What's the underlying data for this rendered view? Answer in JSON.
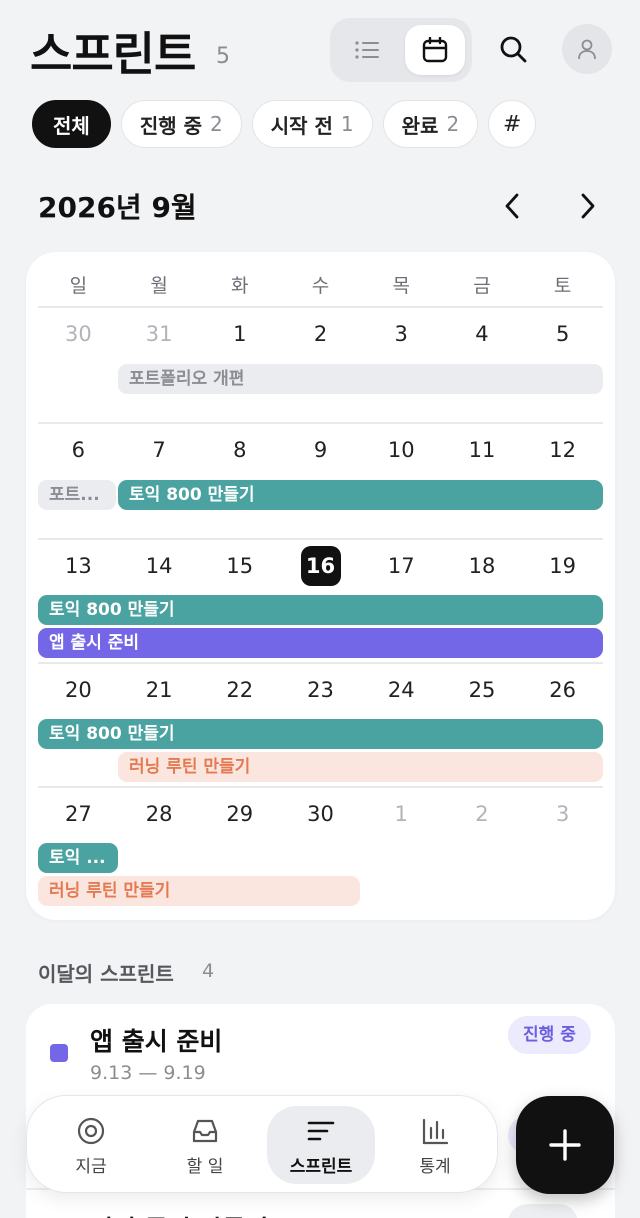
{
  "header": {
    "title": "스프린트",
    "count": "5",
    "view_toggle": {
      "list_icon": "list-icon",
      "calendar_icon": "calendar-icon",
      "active": "calendar"
    },
    "search_icon": "search-icon",
    "profile_icon": "user-icon"
  },
  "filters": [
    {
      "label": "전체",
      "count": "",
      "active": true
    },
    {
      "label": "진행 중",
      "count": "2",
      "active": false
    },
    {
      "label": "시작 전",
      "count": "1",
      "active": false
    },
    {
      "label": "완료",
      "count": "2",
      "active": false
    },
    {
      "label": "#",
      "count": "",
      "active": false
    }
  ],
  "calendar": {
    "month_label": "2026년 9월",
    "weekdays": [
      "일",
      "월",
      "화",
      "수",
      "목",
      "금",
      "토"
    ],
    "today": "16",
    "weeks": [
      {
        "days": [
          "30",
          "31",
          "1",
          "2",
          "3",
          "4",
          "5"
        ],
        "events": [
          {
            "label": "포트폴리오 개편",
            "color": "gray"
          }
        ]
      },
      {
        "days": [
          "6",
          "7",
          "8",
          "9",
          "10",
          "11",
          "12"
        ],
        "events": [
          {
            "label": "포트...",
            "color": "gray"
          },
          {
            "label": "토익 800 만들기",
            "color": "teal"
          }
        ]
      },
      {
        "days": [
          "13",
          "14",
          "15",
          "16",
          "17",
          "18",
          "19"
        ],
        "events": [
          {
            "label": "토익 800 만들기",
            "color": "teal"
          },
          {
            "label": "앱 출시 준비",
            "color": "purple"
          }
        ]
      },
      {
        "days": [
          "20",
          "21",
          "22",
          "23",
          "24",
          "25",
          "26"
        ],
        "events": [
          {
            "label": "토익 800 만들기",
            "color": "teal"
          },
          {
            "label": "러닝 루틴 만들기",
            "color": "peach"
          }
        ]
      },
      {
        "days": [
          "27",
          "28",
          "29",
          "30",
          "1",
          "2",
          "3"
        ],
        "events": [
          {
            "label": "토익 ...",
            "color": "teal"
          },
          {
            "label": "러닝 루틴 만들기",
            "color": "peach"
          }
        ]
      }
    ]
  },
  "month_sprints": {
    "title": "이달의 스프린트",
    "count": "4",
    "items": [
      {
        "name": "앱 출시 준비",
        "dates": "9.13 — 9.19",
        "status": "진행 중",
        "color": "#7367e8"
      },
      {
        "name": "러닝 루틴 만들기"
      }
    ]
  },
  "tabbar": [
    {
      "label": "지금",
      "icon": "target-icon",
      "active": false
    },
    {
      "label": "할 일",
      "icon": "inbox-icon",
      "active": false
    },
    {
      "label": "스프린트",
      "icon": "sprint-lines-icon",
      "active": true
    },
    {
      "label": "통계",
      "icon": "bar-chart-icon",
      "active": false
    }
  ],
  "fab": {
    "icon": "plus-icon"
  },
  "colors": {
    "teal": "#4aa3a1",
    "purple": "#7367e8",
    "peach_bg": "#fbe6df",
    "peach_text": "#e47a52",
    "gray_bg": "#ebecef"
  }
}
